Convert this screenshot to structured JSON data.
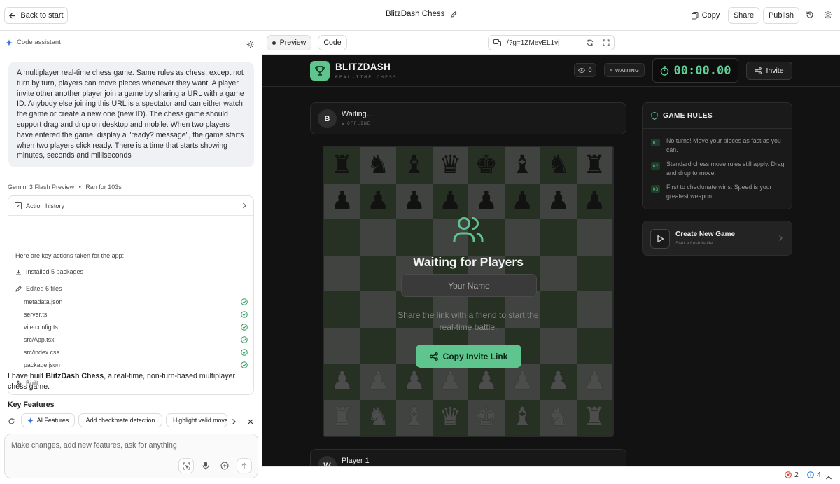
{
  "topbar": {
    "back_label": "Back to start",
    "project_title": "BlitzDash Chess",
    "copy_label": "Copy",
    "share_label": "Share",
    "publish_label": "Publish"
  },
  "assistant": {
    "label": "Code assistant",
    "prompt": "A multiplayer real-time chess game. Same rules as chess, except not turn by turn, players can move pieces whenever they want. A player invite other another player join a game by sharing a URL with a game ID. Anybody else joining this URL is a spectator and can either watch the game or create a new one (new ID). The chess game should support drag and drop on desktop and mobile. When two players have entered the game, display a \"ready? message\", the game starts when two players click ready. There is a time that starts showing minutes, seconds and milliseconds",
    "model": "Gemini 3 Flash Preview",
    "ran_for": "Ran for 103s",
    "action_history_label": "Action history",
    "actions_intro": "Here are key actions taken for the app:",
    "installed": "Installed 5 packages",
    "edited": "Edited 6 files",
    "files": [
      "metadata.json",
      "server.ts",
      "vite.config.ts",
      "src/App.tsx",
      "src/index.css",
      "package.json"
    ],
    "built": "Built",
    "summary_pre": "I have built ",
    "summary_bold": "BlitzDash Chess",
    "summary_post": ", a real-time, non-turn-based multiplayer chess game.",
    "key_features": "Key Features",
    "chips": [
      "AI Features",
      "Add checkmate detection",
      "Highlight valid move"
    ],
    "input_placeholder": "Make changes, add new features, ask for anything"
  },
  "preview": {
    "tab_preview": "Preview",
    "tab_code": "Code",
    "url": "/?g=1ZMevEL1vj"
  },
  "app": {
    "brand": "BLITZDASH",
    "brand_sub": "REAL-TIME CHESS",
    "spectators": "0",
    "status": "WAITING",
    "timer": "00:00.00",
    "invite_label": "Invite",
    "top_player": {
      "avatar": "B",
      "name": "Waiting...",
      "status": "OFFLINE"
    },
    "bottom_player": {
      "avatar": "W",
      "name": "Player 1"
    },
    "overlay": {
      "title": "Waiting for Players",
      "name_placeholder": "Your Name",
      "text": "Share the link with a friend to start the real-time battle.",
      "button": "Copy Invite Link"
    },
    "rules": {
      "title": "GAME RULES",
      "items": [
        {
          "num": "01",
          "text": "No turns! Move your pieces as fast as you can."
        },
        {
          "num": "02",
          "text": "Standard chess move rules still apply. Drag and drop to move."
        },
        {
          "num": "03",
          "text": "First to checkmate wins. Speed is your greatest weapon."
        }
      ]
    },
    "new_game": {
      "title": "Create New Game",
      "subtitle": "Start a fresh battle"
    }
  },
  "statusbar": {
    "errors": "2",
    "infos": "4"
  },
  "colors": {
    "accent": "#5fc58e",
    "app_bg": "#121212",
    "timer": "#5fd197"
  }
}
